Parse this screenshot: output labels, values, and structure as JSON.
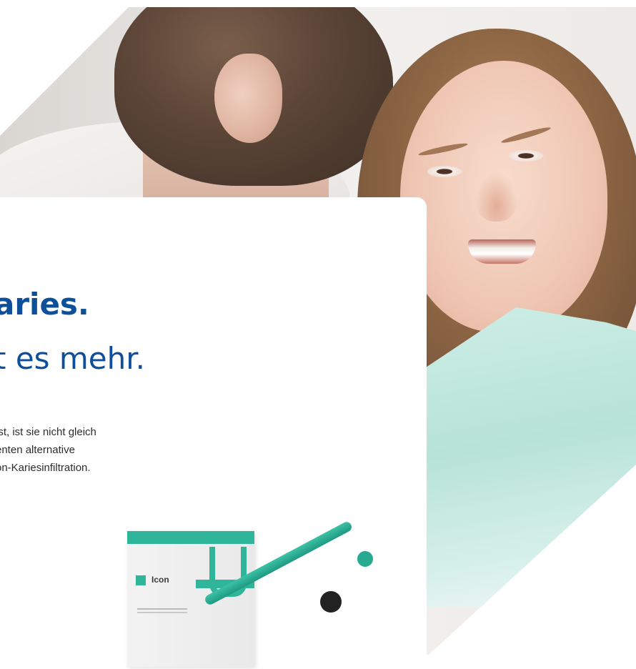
{
  "hero": {
    "headline_line1": "aries.",
    "headline_line2": "t es mehr.",
    "body_lines": [
      "ist, ist sie nicht gleich",
      "enten alternative",
      "on-Kariesinfiltration."
    ]
  },
  "product": {
    "box_name": "Icon"
  },
  "colors": {
    "headline": "#0e4f9a",
    "accent": "#2fb59a",
    "body_text": "#2d2d2d"
  }
}
